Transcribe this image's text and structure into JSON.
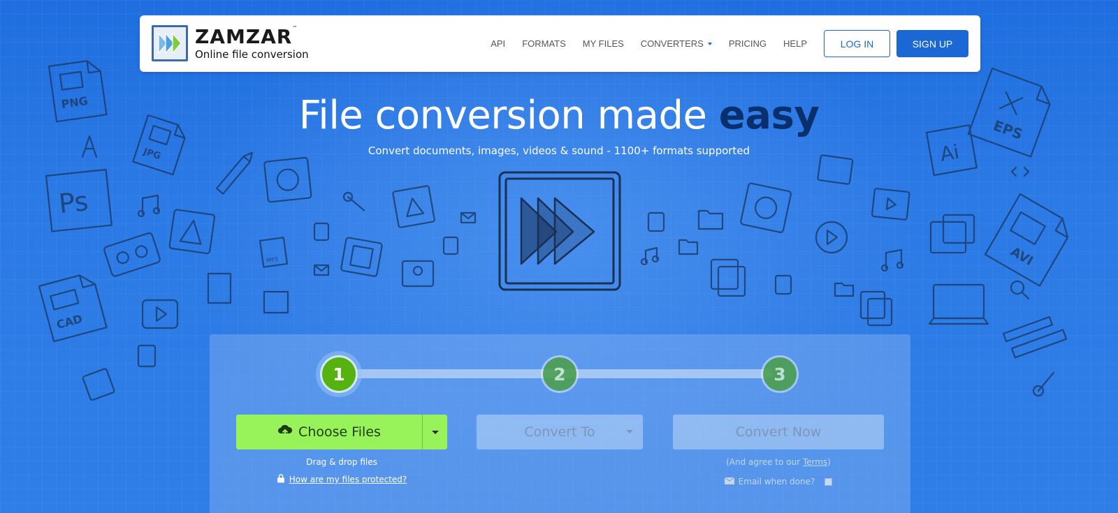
{
  "header": {
    "logo": {
      "brand": "ZAMZAR",
      "trademark": "™",
      "tagline": "Online file conversion",
      "icon": "zamzar-logo-icon"
    },
    "nav": [
      {
        "label": "API"
      },
      {
        "label": "FORMATS"
      },
      {
        "label": "MY FILES"
      },
      {
        "label": "CONVERTERS",
        "has_dropdown": true
      },
      {
        "label": "PRICING"
      },
      {
        "label": "HELP"
      }
    ],
    "login_label": "LOG IN",
    "signup_label": "SIGN UP"
  },
  "hero": {
    "title_main": "File conversion made",
    "title_emphasis": "easy",
    "subtitle": "Convert documents, images, videos & sound - 1100+ formats supported"
  },
  "decorations": {
    "format_labels": [
      "PNG",
      "JPG",
      "Ps",
      "CAD",
      "EPS",
      "Ai",
      "AVI",
      "MP3"
    ]
  },
  "converter": {
    "steps": [
      "1",
      "2",
      "3"
    ],
    "choose_files_label": "Choose Files",
    "drag_drop_text": "Drag & drop files",
    "protect_link": "How are my files protected?",
    "convert_to_label": "Convert To",
    "convert_now_label": "Convert Now",
    "terms_prefix": "(And agree to our ",
    "terms_link": "Terms",
    "terms_suffix": ")",
    "email_label": "Email when done?"
  },
  "colors": {
    "background": "#2a78e4",
    "brand_blue": "#1b67d3",
    "title_emphasis": "#0a2f6e",
    "choose_green": "#98f25a",
    "step_active": "#56b20f",
    "step_inactive": "#4c9f4f"
  }
}
